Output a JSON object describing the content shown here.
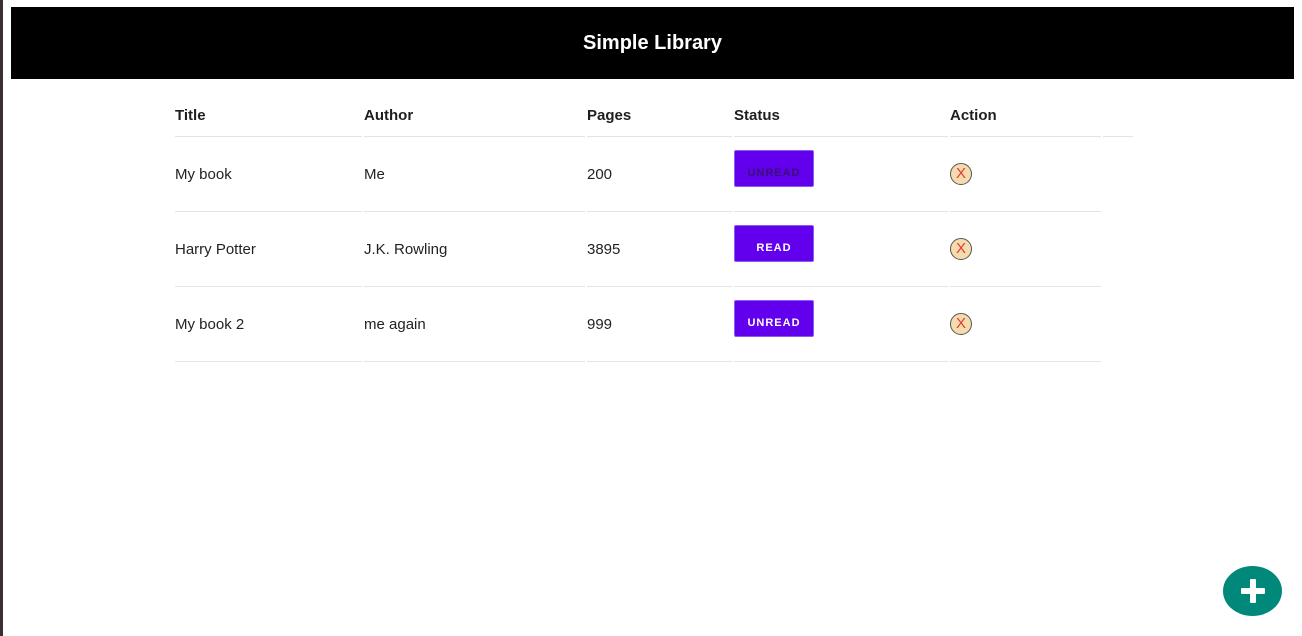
{
  "header": {
    "title": "Simple Library"
  },
  "table": {
    "columns": [
      "Title",
      "Author",
      "Pages",
      "Status",
      "Action"
    ],
    "rows": [
      {
        "title": "My book",
        "author": "Me",
        "pages": "200",
        "status": "UNREAD",
        "action": "X"
      },
      {
        "title": "Harry Potter",
        "author": "J.K. Rowling",
        "pages": "3895",
        "status": "READ",
        "action": "X"
      },
      {
        "title": "My book 2",
        "author": "me again",
        "pages": "999",
        "status": "UNREAD",
        "action": "X"
      }
    ]
  },
  "fab": {
    "icon": "plus-icon"
  },
  "colors": {
    "header_bg": "#000000",
    "status_button": "#6200ee",
    "fab": "#00897b",
    "delete_bg": "#f4dcae",
    "delete_x": "#e53935"
  }
}
